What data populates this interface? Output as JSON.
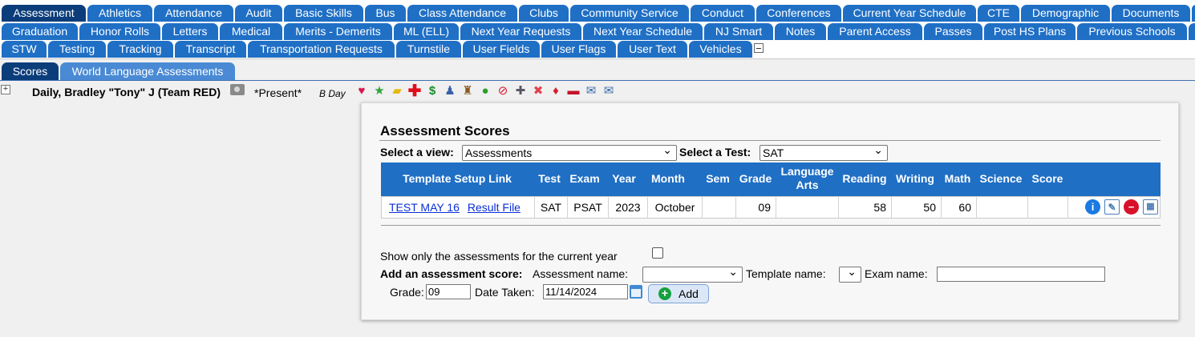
{
  "tabs": {
    "row1": [
      "Assessment",
      "Athletics",
      "Attendance",
      "Audit",
      "Basic Skills",
      "Bus",
      "Class Attendance",
      "Clubs",
      "Community Service",
      "Conduct",
      "Conferences",
      "Current Year Schedule",
      "CTE",
      "Demographic",
      "Documents"
    ],
    "row2": [
      "Graduation",
      "Honor Rolls",
      "Letters",
      "Medical",
      "Merits - Demerits",
      "ML (ELL)",
      "Next Year Requests",
      "Next Year Schedule",
      "NJ Smart",
      "Notes",
      "Parent Access",
      "Passes",
      "Post HS Plans",
      "Previous Schools"
    ],
    "row3": [
      "STW",
      "Testing",
      "Tracking",
      "Transcript",
      "Transportation Requests",
      "Turnstile",
      "User Fields",
      "User Flags",
      "User Text",
      "Vehicles"
    ],
    "active": "Assessment"
  },
  "subtabs": [
    "Scores",
    "World Language Assessments"
  ],
  "student": {
    "name": "Daily, Bradley \"Tony\" J (Team RED)",
    "status": "*Present*",
    "day": "B Day",
    "flag_icons": [
      "heart-icon",
      "star-icon",
      "folder-icon",
      "medical-cross-icon",
      "dollar-icon",
      "person-icon",
      "graduate-icon",
      "speech-bubble-icon",
      "no-entry-icon",
      "plus-icon",
      "cancel-icon",
      "card-icon",
      "car-icon",
      "email-check-icon",
      "email-x-icon"
    ]
  },
  "panel": {
    "title": "Assessment Scores",
    "view_label": "Select a view:",
    "view_value": "Assessments",
    "test_label": "Select a Test:",
    "test_value": "SAT"
  },
  "table": {
    "headers": [
      "Template Setup Link",
      "Test",
      "Exam",
      "Year",
      "Month",
      "Sem",
      "Grade",
      "Language Arts",
      "Reading",
      "Writing",
      "Math",
      "Science",
      "Score"
    ],
    "rows": [
      {
        "template": "TEST MAY 16",
        "link": "Result File",
        "test": "SAT",
        "exam": "PSAT",
        "year": "2023",
        "month": "October",
        "sem": "",
        "grade": "09",
        "language_arts": "",
        "reading": "58",
        "writing": "50",
        "math": "60",
        "science": "",
        "score": ""
      }
    ]
  },
  "filter": {
    "only_current_label": "Show only the assessments for the current year"
  },
  "add_form": {
    "label": "Add an assessment score:",
    "assessment_name_label": "Assessment name:",
    "assessment_name_value": "",
    "template_name_label": "Template name:",
    "template_name_value": "",
    "exam_name_label": "Exam name:",
    "exam_name_value": "",
    "grade_label": "Grade:",
    "grade_value": "09",
    "date_label": "Date Taken:",
    "date_value": "11/14/2024",
    "add_button": "Add"
  },
  "colors": {
    "tab": "#1f6fc5",
    "tab_active": "#0b3d7a",
    "link": "#0a2fd6",
    "header": "#1f6fc5"
  }
}
